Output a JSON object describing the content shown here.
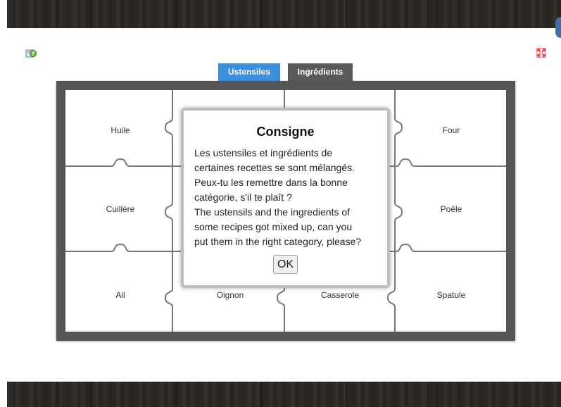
{
  "tabs": [
    {
      "label": "Ustensiles",
      "active": true
    },
    {
      "label": "Ingrédients",
      "active": false
    }
  ],
  "puzzle": {
    "cells": [
      {
        "label": "Huile"
      },
      {
        "label": ""
      },
      {
        "label": ""
      },
      {
        "label": "Four"
      },
      {
        "label": "Cuillère"
      },
      {
        "label": ""
      },
      {
        "label": ""
      },
      {
        "label": "Poêle"
      },
      {
        "label": "Ail"
      },
      {
        "label": "Oignon"
      },
      {
        "label": "Casserole"
      },
      {
        "label": "Spatule"
      }
    ]
  },
  "dialog": {
    "title": "Consigne",
    "lines": [
      "Les ustensiles et ingrédients de",
      "certaines recettes se sont mélangés.",
      "Peux-tu les remettre dans la bonne",
      "catégorie, s'il te plaît ?",
      "The ustensils and the ingredients of",
      "some recipes got mixed up, can you",
      "put them in the right category, please?"
    ],
    "ok_label": "OK"
  },
  "icons": {
    "help": "help-icon",
    "fullscreen": "fullscreen-icon"
  },
  "colors": {
    "tab_active": "#3d8fdb",
    "tab_inactive": "#5a5a5a",
    "board_frame": "#555555"
  }
}
